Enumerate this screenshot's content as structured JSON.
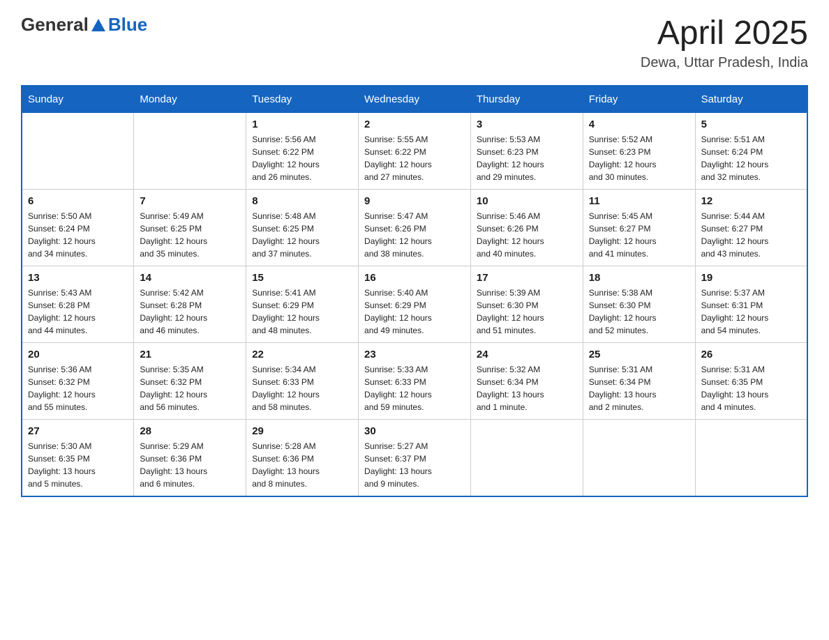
{
  "header": {
    "logo_general": "General",
    "logo_blue": "Blue",
    "title": "April 2025",
    "subtitle": "Dewa, Uttar Pradesh, India"
  },
  "days_of_week": [
    "Sunday",
    "Monday",
    "Tuesday",
    "Wednesday",
    "Thursday",
    "Friday",
    "Saturday"
  ],
  "weeks": [
    [
      {
        "day": "",
        "info": ""
      },
      {
        "day": "",
        "info": ""
      },
      {
        "day": "1",
        "info": "Sunrise: 5:56 AM\nSunset: 6:22 PM\nDaylight: 12 hours\nand 26 minutes."
      },
      {
        "day": "2",
        "info": "Sunrise: 5:55 AM\nSunset: 6:22 PM\nDaylight: 12 hours\nand 27 minutes."
      },
      {
        "day": "3",
        "info": "Sunrise: 5:53 AM\nSunset: 6:23 PM\nDaylight: 12 hours\nand 29 minutes."
      },
      {
        "day": "4",
        "info": "Sunrise: 5:52 AM\nSunset: 6:23 PM\nDaylight: 12 hours\nand 30 minutes."
      },
      {
        "day": "5",
        "info": "Sunrise: 5:51 AM\nSunset: 6:24 PM\nDaylight: 12 hours\nand 32 minutes."
      }
    ],
    [
      {
        "day": "6",
        "info": "Sunrise: 5:50 AM\nSunset: 6:24 PM\nDaylight: 12 hours\nand 34 minutes."
      },
      {
        "day": "7",
        "info": "Sunrise: 5:49 AM\nSunset: 6:25 PM\nDaylight: 12 hours\nand 35 minutes."
      },
      {
        "day": "8",
        "info": "Sunrise: 5:48 AM\nSunset: 6:25 PM\nDaylight: 12 hours\nand 37 minutes."
      },
      {
        "day": "9",
        "info": "Sunrise: 5:47 AM\nSunset: 6:26 PM\nDaylight: 12 hours\nand 38 minutes."
      },
      {
        "day": "10",
        "info": "Sunrise: 5:46 AM\nSunset: 6:26 PM\nDaylight: 12 hours\nand 40 minutes."
      },
      {
        "day": "11",
        "info": "Sunrise: 5:45 AM\nSunset: 6:27 PM\nDaylight: 12 hours\nand 41 minutes."
      },
      {
        "day": "12",
        "info": "Sunrise: 5:44 AM\nSunset: 6:27 PM\nDaylight: 12 hours\nand 43 minutes."
      }
    ],
    [
      {
        "day": "13",
        "info": "Sunrise: 5:43 AM\nSunset: 6:28 PM\nDaylight: 12 hours\nand 44 minutes."
      },
      {
        "day": "14",
        "info": "Sunrise: 5:42 AM\nSunset: 6:28 PM\nDaylight: 12 hours\nand 46 minutes."
      },
      {
        "day": "15",
        "info": "Sunrise: 5:41 AM\nSunset: 6:29 PM\nDaylight: 12 hours\nand 48 minutes."
      },
      {
        "day": "16",
        "info": "Sunrise: 5:40 AM\nSunset: 6:29 PM\nDaylight: 12 hours\nand 49 minutes."
      },
      {
        "day": "17",
        "info": "Sunrise: 5:39 AM\nSunset: 6:30 PM\nDaylight: 12 hours\nand 51 minutes."
      },
      {
        "day": "18",
        "info": "Sunrise: 5:38 AM\nSunset: 6:30 PM\nDaylight: 12 hours\nand 52 minutes."
      },
      {
        "day": "19",
        "info": "Sunrise: 5:37 AM\nSunset: 6:31 PM\nDaylight: 12 hours\nand 54 minutes."
      }
    ],
    [
      {
        "day": "20",
        "info": "Sunrise: 5:36 AM\nSunset: 6:32 PM\nDaylight: 12 hours\nand 55 minutes."
      },
      {
        "day": "21",
        "info": "Sunrise: 5:35 AM\nSunset: 6:32 PM\nDaylight: 12 hours\nand 56 minutes."
      },
      {
        "day": "22",
        "info": "Sunrise: 5:34 AM\nSunset: 6:33 PM\nDaylight: 12 hours\nand 58 minutes."
      },
      {
        "day": "23",
        "info": "Sunrise: 5:33 AM\nSunset: 6:33 PM\nDaylight: 12 hours\nand 59 minutes."
      },
      {
        "day": "24",
        "info": "Sunrise: 5:32 AM\nSunset: 6:34 PM\nDaylight: 13 hours\nand 1 minute."
      },
      {
        "day": "25",
        "info": "Sunrise: 5:31 AM\nSunset: 6:34 PM\nDaylight: 13 hours\nand 2 minutes."
      },
      {
        "day": "26",
        "info": "Sunrise: 5:31 AM\nSunset: 6:35 PM\nDaylight: 13 hours\nand 4 minutes."
      }
    ],
    [
      {
        "day": "27",
        "info": "Sunrise: 5:30 AM\nSunset: 6:35 PM\nDaylight: 13 hours\nand 5 minutes."
      },
      {
        "day": "28",
        "info": "Sunrise: 5:29 AM\nSunset: 6:36 PM\nDaylight: 13 hours\nand 6 minutes."
      },
      {
        "day": "29",
        "info": "Sunrise: 5:28 AM\nSunset: 6:36 PM\nDaylight: 13 hours\nand 8 minutes."
      },
      {
        "day": "30",
        "info": "Sunrise: 5:27 AM\nSunset: 6:37 PM\nDaylight: 13 hours\nand 9 minutes."
      },
      {
        "day": "",
        "info": ""
      },
      {
        "day": "",
        "info": ""
      },
      {
        "day": "",
        "info": ""
      }
    ]
  ]
}
